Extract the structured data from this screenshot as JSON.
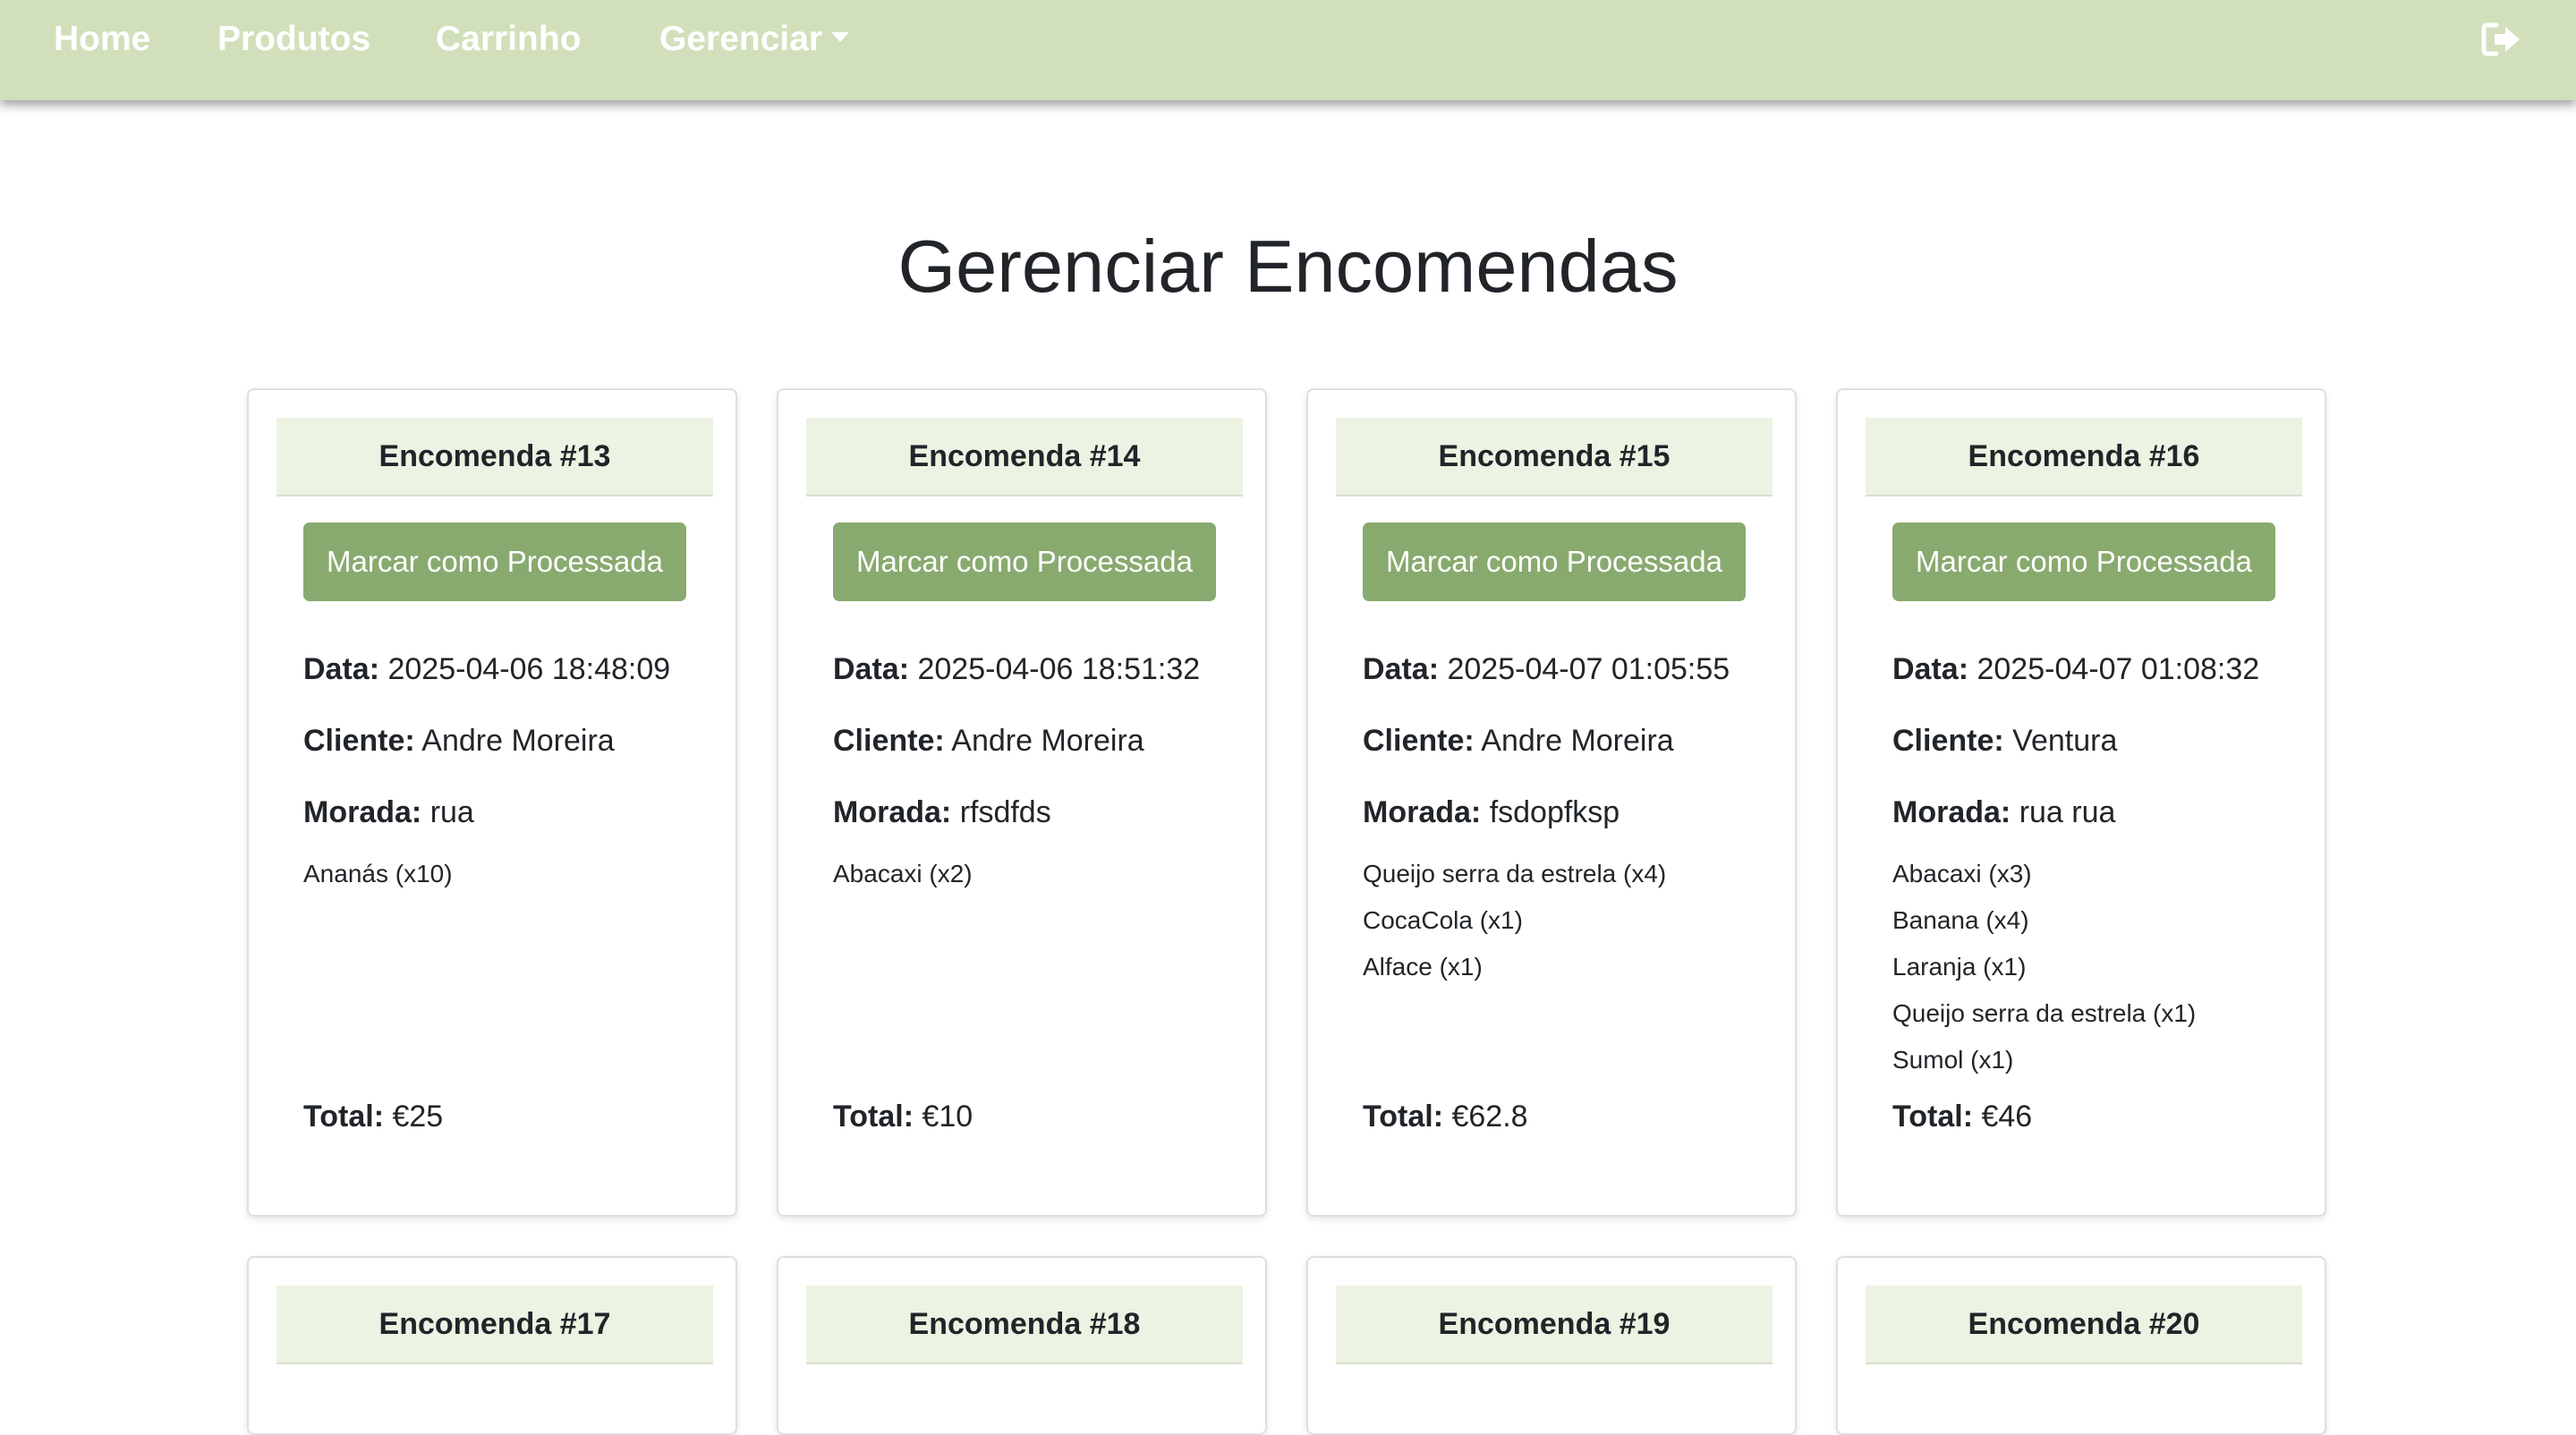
{
  "nav": {
    "home": "Home",
    "produtos": "Produtos",
    "carrinho": "Carrinho",
    "gerenciar": "Gerenciar",
    "logout_icon": "sign-out-icon"
  },
  "page": {
    "title": "Gerenciar Encomendas"
  },
  "labels": {
    "data": "Data:",
    "cliente": "Cliente:",
    "morada": "Morada:",
    "total": "Total:",
    "process_button": "Marcar como Processada"
  },
  "colors": {
    "navbar": "#d1e0bb",
    "card_header": "#ecf3e2",
    "button": "#89aa6f"
  },
  "orders": [
    {
      "title": "Encomenda #13",
      "data": "2025-04-06 18:48:09",
      "cliente": "Andre Moreira",
      "morada": "rua",
      "items": [
        "Ananás (x10)"
      ],
      "total": "€25"
    },
    {
      "title": "Encomenda #14",
      "data": "2025-04-06 18:51:32",
      "cliente": "Andre Moreira",
      "morada": "rfsdfds",
      "items": [
        "Abacaxi (x2)"
      ],
      "total": "€10"
    },
    {
      "title": "Encomenda #15",
      "data": "2025-04-07 01:05:55",
      "cliente": "Andre Moreira",
      "morada": "fsdopfksp",
      "items": [
        "Queijo serra da estrela (x4)",
        "CocaCola (x1)",
        "Alface (x1)"
      ],
      "total": "€62.8"
    },
    {
      "title": "Encomenda #16",
      "data": "2025-04-07 01:08:32",
      "cliente": "Ventura",
      "morada": "rua rua",
      "items": [
        "Abacaxi (x3)",
        "Banana (x4)",
        "Laranja (x1)",
        "Queijo serra da estrela (x1)",
        "Sumol (x1)"
      ],
      "total": "€46"
    }
  ],
  "more_orders": [
    {
      "title": "Encomenda #17"
    },
    {
      "title": "Encomenda #18"
    },
    {
      "title": "Encomenda #19"
    },
    {
      "title": "Encomenda #20"
    }
  ]
}
